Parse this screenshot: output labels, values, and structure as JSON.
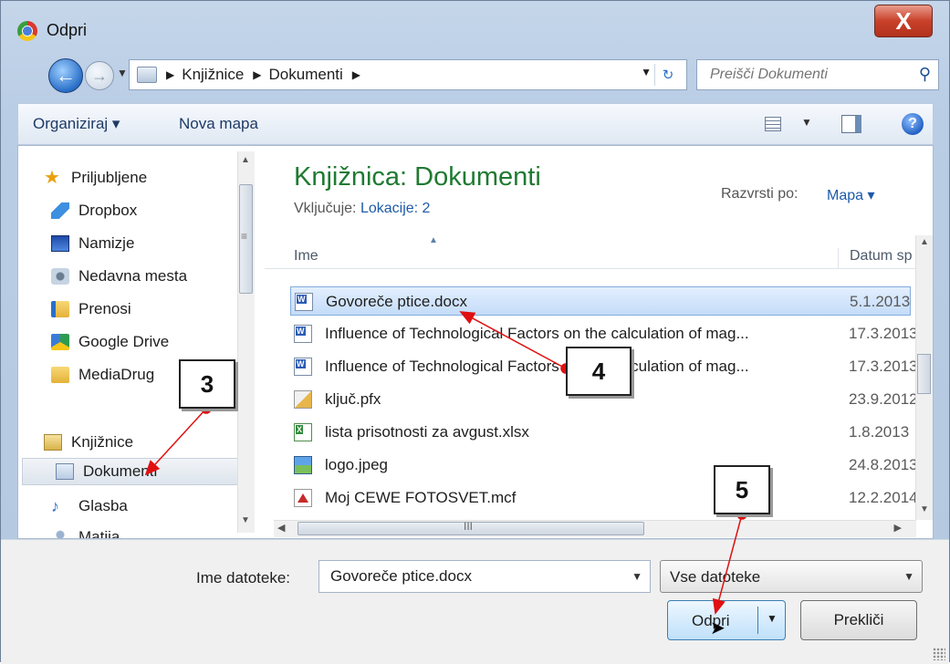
{
  "window": {
    "title": "Odpri",
    "close_label": "X"
  },
  "address": {
    "crumbs": [
      "Knjižnice",
      "Dokumenti"
    ],
    "search_placeholder": "Preišči Dokumenti"
  },
  "toolbar": {
    "organize": "Organiziraj ▾",
    "new_folder": "Nova mapa"
  },
  "nav": {
    "favorites_header": "Priljubljene",
    "items": [
      "Dropbox",
      "Namizje",
      "Nedavna mesta",
      "Prenosi",
      "Google Drive",
      "MediaDrug"
    ],
    "libraries_header": "Knjižnice",
    "library_items": [
      "Dokumenti",
      "Glasba",
      "Matija"
    ]
  },
  "library": {
    "title": "Knjižnica: Dokumenti",
    "includes_label": "Vključuje:",
    "includes_link": "Lokacije: 2",
    "sort_label": "Razvrsti po:",
    "sort_value": "Mapa ▾"
  },
  "columns": {
    "name": "Ime",
    "date": "Datum sp"
  },
  "files": [
    {
      "name": "Govoreče ptice.docx",
      "date": "5.1.2013",
      "icon": "word-icon"
    },
    {
      "name": "Influence of Technological Factors on the calculation of mag...",
      "date": "17.3.2013",
      "icon": "word-icon"
    },
    {
      "name": "Influence of Technological Factors on the calculation of mag...",
      "date": "17.3.2013",
      "icon": "word-icon"
    },
    {
      "name": "ključ.pfx",
      "date": "23.9.2012",
      "icon": "certificate-icon"
    },
    {
      "name": "lista prisotnosti za avgust.xlsx",
      "date": "1.8.2013",
      "icon": "excel-icon"
    },
    {
      "name": "logo.jpeg",
      "date": "24.8.2013",
      "icon": "image-icon"
    },
    {
      "name": "Moj CEWE FOTOSVET.mcf",
      "date": "12.2.2014",
      "icon": "cewe-icon"
    }
  ],
  "bottom": {
    "filename_label": "Ime datoteke:",
    "filename_value": "Govoreče ptice.docx",
    "filetype_value": "Vse datoteke",
    "open_label": "Odpri",
    "cancel_label": "Prekliči"
  },
  "annotations": {
    "step3": "3",
    "step4": "4",
    "step5": "5",
    "arrow_color": "#e01010"
  }
}
